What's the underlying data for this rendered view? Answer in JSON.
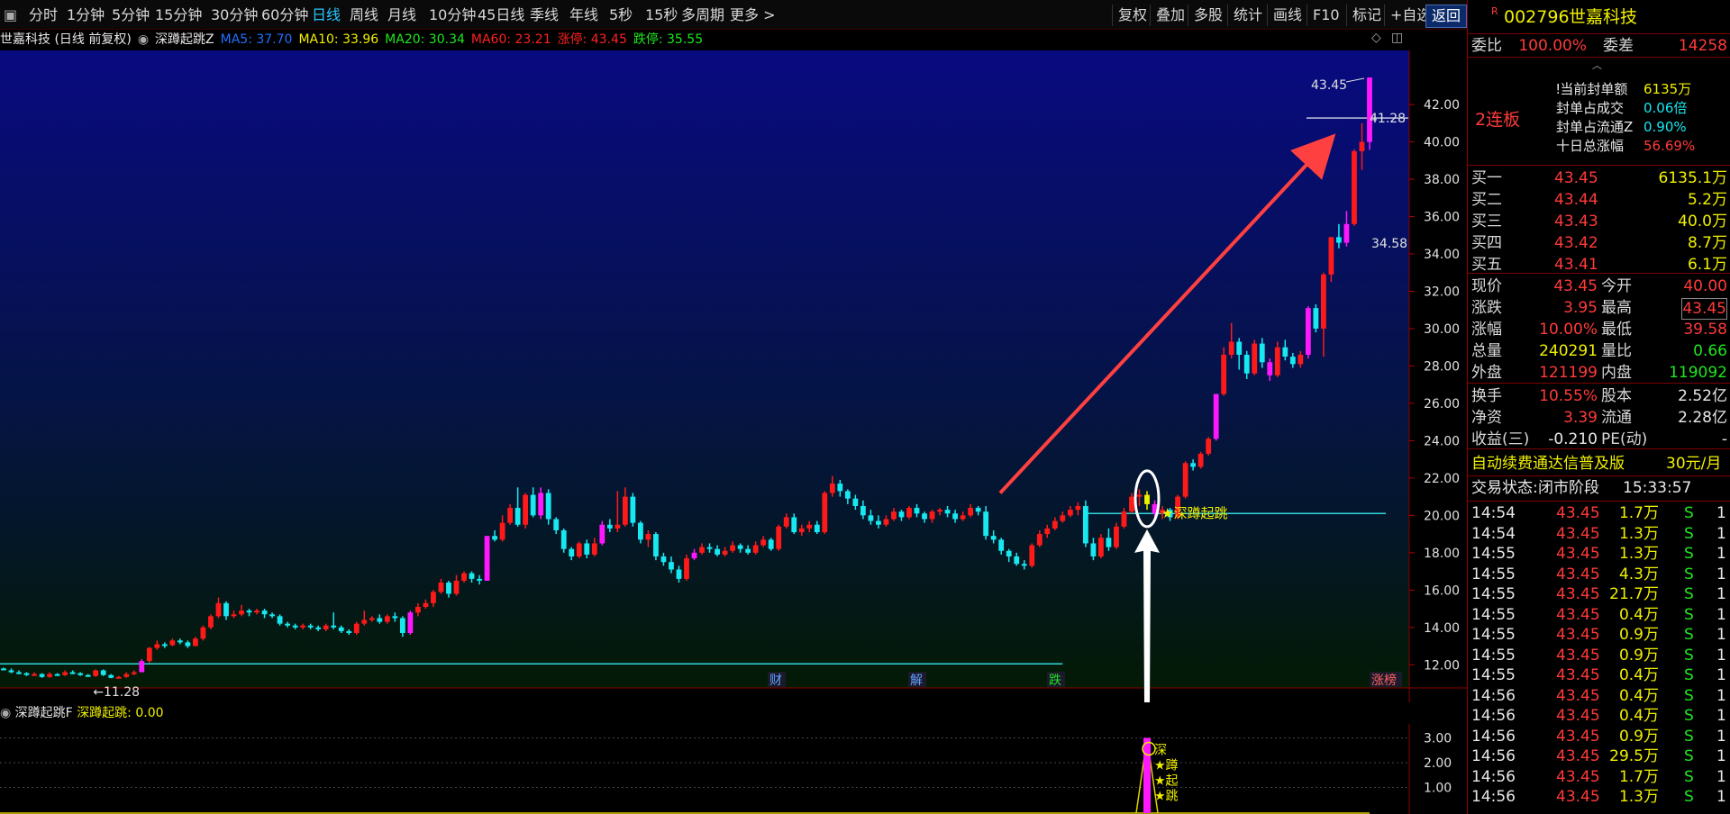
{
  "toolbar": {
    "periods": [
      "分时",
      "1分钟",
      "5分钟",
      "15分钟",
      "30分钟",
      "60分钟",
      "日线",
      "周线",
      "月线",
      "10分钟",
      "45日线",
      "季线",
      "年线",
      "5秒",
      "15秒",
      "多周期",
      "更多 >"
    ],
    "active": "日线",
    "right_buttons": [
      "复权",
      "叠加",
      "多股",
      "统计",
      "画线",
      "F10",
      "标记",
      "+自选",
      "返回"
    ]
  },
  "chart_header": {
    "title": "世嘉科技 (日线 前复权)",
    "indicator": "深蹲起跳Z",
    "ma5": "MA5: 37.70",
    "ma10": "MA10: 33.96",
    "ma20": "MA20: 30.34",
    "ma60": "MA60: 23.21",
    "limit_up": "涨停: 43.45",
    "limit_down": "跌停: 35.55",
    "colors": {
      "ma5": "#2070ff",
      "ma10": "#f0f000",
      "ma20": "#1ee81e",
      "ma60": "#ff2020",
      "limit_up": "#ff2020",
      "limit_down": "#1ee81e"
    }
  },
  "main_chart": {
    "y_ticks": [
      "42.00",
      "40.00",
      "38.00",
      "36.00",
      "34.00",
      "32.00",
      "30.00",
      "28.00",
      "26.00",
      "24.00",
      "22.00",
      "20.00",
      "18.00",
      "16.00",
      "14.00",
      "12.00"
    ],
    "y_range": [
      11,
      43.5
    ],
    "high_label": "43.45",
    "line_label": "41.28",
    "mid_label": "34.58",
    "low_label": "11.28",
    "signal_label": "深蹲起跳",
    "event_tags": [
      "财",
      "解",
      "跌",
      "涨榜"
    ],
    "colors": {
      "up": "#ff1a1a",
      "down": "#18e8f0",
      "limit": "#ff18ff",
      "signal": "#f0f000"
    }
  },
  "chart_data": {
    "type": "candlestick",
    "note": "日线 OHLC 估算值 (前复权)",
    "bars": [
      [
        11.8,
        11.75,
        11.85,
        11.7
      ],
      [
        11.7,
        11.6,
        11.8,
        11.55
      ],
      [
        11.6,
        11.55,
        11.7,
        11.5
      ],
      [
        11.55,
        11.45,
        11.6,
        11.4
      ],
      [
        11.45,
        11.5,
        11.6,
        11.4
      ],
      [
        11.5,
        11.35,
        11.55,
        11.3
      ],
      [
        11.35,
        11.5,
        11.6,
        11.3
      ],
      [
        11.5,
        11.45,
        11.55,
        11.4
      ],
      [
        11.45,
        11.6,
        11.7,
        11.4
      ],
      [
        11.6,
        11.55,
        11.7,
        11.5
      ],
      [
        11.55,
        11.45,
        11.6,
        11.4
      ],
      [
        11.45,
        11.4,
        11.5,
        11.35
      ],
      [
        11.4,
        11.7,
        11.75,
        11.35
      ],
      [
        11.7,
        11.45,
        11.75,
        11.4
      ],
      [
        11.45,
        11.3,
        11.5,
        11.28
      ],
      [
        11.3,
        11.35,
        11.4,
        11.28
      ],
      [
        11.35,
        11.5,
        11.6,
        11.3
      ],
      [
        11.5,
        11.6,
        11.7,
        11.45
      ],
      [
        11.6,
        12.2,
        12.3,
        11.6
      ],
      [
        12.2,
        12.9,
        12.95,
        12.1
      ],
      [
        12.9,
        13.1,
        13.3,
        12.8
      ],
      [
        13.1,
        13.05,
        13.2,
        12.9
      ],
      [
        13.05,
        13.3,
        13.4,
        13.0
      ],
      [
        13.3,
        13.2,
        13.4,
        13.1
      ],
      [
        13.2,
        13.0,
        13.3,
        12.9
      ],
      [
        13.0,
        13.4,
        13.5,
        13.0
      ],
      [
        13.4,
        14.0,
        14.1,
        13.3
      ],
      [
        14.0,
        14.6,
        14.7,
        13.9
      ],
      [
        14.6,
        15.3,
        15.6,
        14.5
      ],
      [
        15.3,
        14.6,
        15.4,
        14.4
      ],
      [
        14.6,
        14.7,
        14.9,
        14.5
      ],
      [
        14.7,
        14.9,
        15.2,
        14.6
      ],
      [
        14.9,
        14.8,
        15.0,
        14.6
      ],
      [
        14.8,
        14.9,
        15.0,
        14.7
      ],
      [
        14.9,
        14.7,
        15.0,
        14.5
      ],
      [
        14.7,
        14.6,
        14.8,
        14.5
      ],
      [
        14.6,
        14.2,
        14.7,
        14.1
      ],
      [
        14.2,
        14.1,
        14.3,
        14.0
      ],
      [
        14.1,
        14.0,
        14.2,
        13.9
      ],
      [
        14.0,
        14.1,
        14.2,
        13.9
      ],
      [
        14.1,
        14.0,
        14.2,
        13.9
      ],
      [
        14.0,
        13.9,
        14.1,
        13.8
      ],
      [
        13.9,
        14.1,
        14.2,
        13.8
      ],
      [
        14.1,
        14.0,
        14.8,
        13.9
      ],
      [
        14.0,
        13.8,
        14.1,
        13.7
      ],
      [
        13.8,
        13.7,
        13.9,
        13.6
      ],
      [
        13.7,
        14.2,
        14.3,
        13.6
      ],
      [
        14.2,
        14.4,
        14.9,
        14.1
      ],
      [
        14.4,
        14.5,
        14.6,
        14.3
      ],
      [
        14.5,
        14.3,
        14.7,
        14.2
      ],
      [
        14.3,
        14.6,
        14.7,
        14.2
      ],
      [
        14.6,
        14.5,
        14.8,
        14.3
      ],
      [
        14.5,
        13.7,
        14.6,
        13.5
      ],
      [
        13.7,
        14.8,
        14.9,
        13.6
      ],
      [
        14.8,
        15.1,
        15.3,
        14.6
      ],
      [
        15.1,
        15.3,
        15.5,
        15.0
      ],
      [
        15.3,
        15.9,
        16.0,
        15.1
      ],
      [
        15.9,
        16.4,
        16.6,
        15.8
      ],
      [
        16.4,
        15.8,
        16.5,
        15.6
      ],
      [
        15.8,
        16.5,
        16.8,
        15.7
      ],
      [
        16.5,
        16.9,
        17.0,
        16.4
      ],
      [
        16.9,
        16.6,
        17.0,
        16.4
      ],
      [
        16.6,
        16.5,
        16.8,
        16.3
      ],
      [
        16.5,
        18.9,
        18.9,
        16.5
      ],
      [
        18.9,
        18.7,
        19.2,
        18.6
      ],
      [
        18.7,
        19.6,
        20.0,
        18.6
      ],
      [
        19.6,
        20.4,
        20.6,
        19.5
      ],
      [
        20.4,
        19.5,
        21.5,
        19.4
      ],
      [
        19.5,
        21.1,
        21.2,
        19.3
      ],
      [
        21.1,
        20.0,
        21.5,
        19.9
      ],
      [
        20.0,
        21.2,
        21.5,
        19.8
      ],
      [
        21.2,
        19.8,
        21.4,
        19.5
      ],
      [
        19.8,
        19.2,
        19.9,
        19.0
      ],
      [
        19.2,
        18.2,
        19.3,
        18.0
      ],
      [
        18.2,
        17.8,
        18.3,
        17.6
      ],
      [
        17.8,
        18.5,
        18.6,
        17.7
      ],
      [
        18.5,
        17.9,
        18.7,
        17.7
      ],
      [
        17.9,
        18.5,
        18.8,
        17.8
      ],
      [
        18.5,
        19.5,
        19.7,
        18.4
      ],
      [
        19.5,
        19.3,
        19.8,
        19.1
      ],
      [
        19.3,
        19.5,
        21.3,
        19.1
      ],
      [
        19.5,
        21.0,
        21.5,
        19.4
      ],
      [
        21.0,
        19.6,
        21.2,
        19.4
      ],
      [
        19.6,
        18.7,
        19.7,
        18.5
      ],
      [
        18.7,
        19.0,
        19.2,
        18.3
      ],
      [
        19.0,
        17.8,
        19.1,
        17.6
      ],
      [
        17.8,
        17.5,
        18.0,
        17.3
      ],
      [
        17.5,
        17.1,
        17.8,
        16.9
      ],
      [
        17.1,
        16.6,
        17.3,
        16.4
      ],
      [
        16.6,
        17.7,
        17.9,
        16.5
      ],
      [
        17.7,
        18.0,
        18.2,
        17.6
      ],
      [
        18.0,
        18.3,
        18.5,
        17.9
      ],
      [
        18.3,
        18.2,
        18.5,
        18.0
      ],
      [
        18.2,
        17.9,
        18.4,
        17.8
      ],
      [
        17.9,
        18.1,
        18.3,
        17.8
      ],
      [
        18.1,
        18.4,
        18.6,
        18.0
      ],
      [
        18.4,
        18.2,
        18.5,
        18.0
      ],
      [
        18.2,
        18.0,
        18.4,
        17.9
      ],
      [
        18.0,
        18.4,
        18.6,
        17.9
      ],
      [
        18.4,
        18.7,
        18.9,
        18.3
      ],
      [
        18.7,
        18.2,
        18.8,
        18.1
      ],
      [
        18.2,
        19.4,
        19.5,
        18.1
      ],
      [
        19.4,
        19.9,
        20.1,
        19.3
      ],
      [
        19.9,
        19.1,
        20.1,
        19.0
      ],
      [
        19.1,
        19.3,
        19.5,
        18.9
      ],
      [
        19.3,
        19.5,
        19.7,
        19.1
      ],
      [
        19.5,
        19.1,
        19.7,
        19.0
      ],
      [
        19.1,
        21.2,
        21.3,
        19.0
      ],
      [
        21.2,
        21.7,
        22.1,
        21.0
      ],
      [
        21.7,
        21.3,
        21.9,
        21.0
      ],
      [
        21.3,
        20.9,
        21.4,
        20.6
      ],
      [
        20.9,
        20.5,
        21.1,
        20.3
      ],
      [
        20.5,
        20.0,
        20.8,
        19.8
      ],
      [
        20.0,
        19.7,
        20.3,
        19.5
      ],
      [
        19.7,
        19.5,
        20.0,
        19.3
      ],
      [
        19.5,
        19.8,
        20.0,
        19.4
      ],
      [
        19.8,
        20.2,
        20.4,
        19.7
      ],
      [
        20.2,
        19.9,
        20.3,
        19.7
      ],
      [
        19.9,
        20.4,
        20.5,
        19.8
      ],
      [
        20.4,
        20.1,
        20.6,
        19.9
      ],
      [
        20.1,
        19.8,
        20.2,
        19.6
      ],
      [
        19.8,
        20.2,
        20.3,
        19.6
      ],
      [
        20.2,
        20.3,
        20.4,
        20.0
      ],
      [
        20.3,
        20.1,
        20.5,
        19.9
      ],
      [
        20.1,
        19.8,
        20.3,
        19.6
      ],
      [
        19.8,
        20.0,
        20.2,
        19.7
      ],
      [
        20.0,
        20.4,
        20.6,
        19.9
      ],
      [
        20.4,
        20.2,
        20.5,
        20.0
      ],
      [
        20.2,
        18.9,
        20.5,
        18.7
      ],
      [
        18.9,
        18.7,
        19.2,
        18.5
      ],
      [
        18.7,
        18.1,
        18.8,
        17.9
      ],
      [
        18.1,
        17.8,
        18.2,
        17.5
      ],
      [
        17.8,
        17.4,
        18.0,
        17.3
      ],
      [
        17.4,
        17.3,
        17.6,
        17.1
      ],
      [
        17.3,
        18.4,
        18.5,
        17.2
      ],
      [
        18.4,
        19.0,
        19.2,
        18.3
      ],
      [
        19.0,
        19.3,
        19.5,
        18.8
      ],
      [
        19.3,
        19.7,
        19.9,
        19.2
      ],
      [
        19.7,
        20.0,
        20.2,
        19.6
      ],
      [
        20.0,
        20.3,
        20.5,
        19.9
      ],
      [
        20.3,
        20.5,
        20.7,
        20.0
      ],
      [
        20.5,
        18.5,
        20.8,
        18.3
      ],
      [
        18.5,
        17.8,
        18.8,
        17.6
      ],
      [
        17.8,
        18.8,
        19.0,
        17.7
      ],
      [
        18.8,
        18.3,
        19.3,
        18.1
      ],
      [
        18.3,
        19.4,
        19.6,
        18.2
      ],
      [
        19.4,
        20.2,
        20.4,
        19.3
      ],
      [
        20.2,
        21.0,
        21.2,
        20.1
      ],
      [
        21.0,
        21.1,
        21.4,
        20.5
      ],
      [
        21.1,
        20.6,
        21.3,
        20.3
      ],
      [
        20.6,
        20.1,
        20.8,
        19.9
      ],
      [
        20.1,
        20.3,
        20.5,
        19.8
      ],
      [
        20.3,
        19.9,
        20.4,
        19.7
      ],
      [
        19.9,
        21.0,
        21.1,
        19.8
      ],
      [
        21.0,
        22.8,
        22.9,
        20.9
      ],
      [
        22.8,
        22.6,
        23.0,
        22.4
      ],
      [
        22.6,
        23.3,
        23.4,
        22.5
      ],
      [
        23.3,
        24.1,
        24.2,
        23.2
      ],
      [
        24.1,
        26.5,
        26.5,
        24.0
      ],
      [
        26.5,
        28.6,
        29.0,
        26.4
      ],
      [
        28.6,
        29.3,
        30.3,
        28.4
      ],
      [
        29.3,
        28.6,
        29.5,
        27.8
      ],
      [
        28.6,
        27.6,
        28.8,
        27.3
      ],
      [
        27.6,
        29.2,
        29.4,
        27.5
      ],
      [
        29.2,
        28.2,
        29.5,
        27.9
      ],
      [
        28.2,
        27.5,
        28.4,
        27.2
      ],
      [
        27.5,
        29.0,
        29.3,
        27.4
      ],
      [
        29.0,
        28.5,
        29.4,
        28.3
      ],
      [
        28.5,
        28.1,
        28.7,
        27.9
      ],
      [
        28.1,
        28.6,
        28.8,
        27.9
      ],
      [
        28.6,
        31.1,
        31.2,
        28.4
      ],
      [
        31.1,
        30.0,
        31.3,
        29.8
      ],
      [
        30.0,
        32.9,
        33.0,
        28.5
      ],
      [
        32.9,
        34.9,
        34.9,
        32.5
      ],
      [
        34.9,
        34.6,
        35.6,
        34.3
      ],
      [
        34.6,
        35.6,
        36.3,
        34.4
      ],
      [
        35.6,
        39.5,
        39.6,
        35.5
      ],
      [
        39.5,
        40.0,
        41.0,
        38.5
      ],
      [
        40.0,
        43.45,
        43.45,
        39.58
      ]
    ],
    "limit_up_bars": [
      18,
      53,
      63,
      70,
      78,
      90,
      150,
      158,
      165,
      170,
      175,
      178,
      180,
      182
    ],
    "signal_bar": 149,
    "low_line": 12.05,
    "mid_line": 20.1
  },
  "sub_chart": {
    "title": "深蹲起跳F",
    "value_label": "深蹲起跳: 0.00",
    "y_ticks": [
      "3.00",
      "2.00",
      "1.00"
    ],
    "signal_text": [
      "深",
      "蹲",
      "起",
      "跳"
    ]
  },
  "quote": {
    "code": "002796",
    "name": "世嘉科技",
    "flag": "R",
    "weibi_label": "委比",
    "weibi": "100.00%",
    "weicha_label": "委差",
    "weicha": "14258",
    "limit_info": [
      {
        "label": "当前封单额",
        "value": "6135万"
      },
      {
        "label": "封单占成交",
        "value": "0.06倍"
      },
      {
        "label": "封单占流通Z",
        "value": "0.90%"
      },
      {
        "label": "十日总涨幅",
        "value": "56.69%"
      }
    ],
    "lianban": "2连板",
    "bids": [
      {
        "label": "买一",
        "price": "43.45",
        "vol": "6135.1万"
      },
      {
        "label": "买二",
        "price": "43.44",
        "vol": "5.2万"
      },
      {
        "label": "买三",
        "price": "43.43",
        "vol": "40.0万"
      },
      {
        "label": "买四",
        "price": "43.42",
        "vol": "8.7万"
      },
      {
        "label": "买五",
        "price": "43.41",
        "vol": "6.1万"
      }
    ],
    "stats": [
      {
        "l1": "现价",
        "v1": "43.45",
        "l2": "今开",
        "v2": "40.00"
      },
      {
        "l1": "涨跌",
        "v1": "3.95",
        "l2": "最高",
        "v2": "43.45"
      },
      {
        "l1": "涨幅",
        "v1": "10.00%",
        "l2": "最低",
        "v2": "39.58"
      },
      {
        "l1": "总量",
        "v1": "240291",
        "l2": "量比",
        "v2": "0.66"
      },
      {
        "l1": "外盘",
        "v1": "121199",
        "l2": "内盘",
        "v2": "119092"
      }
    ],
    "stats2": [
      {
        "l1": "换手",
        "v1": "10.55%",
        "l2": "股本",
        "v2": "2.52亿"
      },
      {
        "l1": "净资",
        "v1": "3.39",
        "l2": "流通",
        "v2": "2.28亿"
      },
      {
        "l1": "收益(三)",
        "v1": "-0.210",
        "l2": "PE(动)",
        "v2": "-"
      }
    ],
    "promo": "自动续费通达信普及版",
    "promo_price": "30元/月",
    "status_label": "交易状态:",
    "status": "闭市阶段",
    "time": "15:33:57"
  },
  "ticks": [
    [
      "14:54",
      "43.45",
      "1.7万",
      "S",
      "1"
    ],
    [
      "14:54",
      "43.45",
      "1.3万",
      "S",
      "1"
    ],
    [
      "14:55",
      "43.45",
      "1.3万",
      "S",
      "1"
    ],
    [
      "14:55",
      "43.45",
      "4.3万",
      "S",
      "1"
    ],
    [
      "14:55",
      "43.45",
      "21.7万",
      "S",
      "1"
    ],
    [
      "14:55",
      "43.45",
      "0.4万",
      "S",
      "1"
    ],
    [
      "14:55",
      "43.45",
      "0.9万",
      "S",
      "1"
    ],
    [
      "14:55",
      "43.45",
      "0.9万",
      "S",
      "1"
    ],
    [
      "14:55",
      "43.45",
      "0.4万",
      "S",
      "1"
    ],
    [
      "14:56",
      "43.45",
      "0.4万",
      "S",
      "1"
    ],
    [
      "14:56",
      "43.45",
      "0.4万",
      "S",
      "1"
    ],
    [
      "14:56",
      "43.45",
      "0.9万",
      "S",
      "1"
    ],
    [
      "14:56",
      "43.45",
      "29.5万",
      "S",
      "1"
    ],
    [
      "14:56",
      "43.45",
      "1.7万",
      "S",
      "1"
    ],
    [
      "14:56",
      "43.45",
      "1.3万",
      "S",
      "1"
    ]
  ]
}
